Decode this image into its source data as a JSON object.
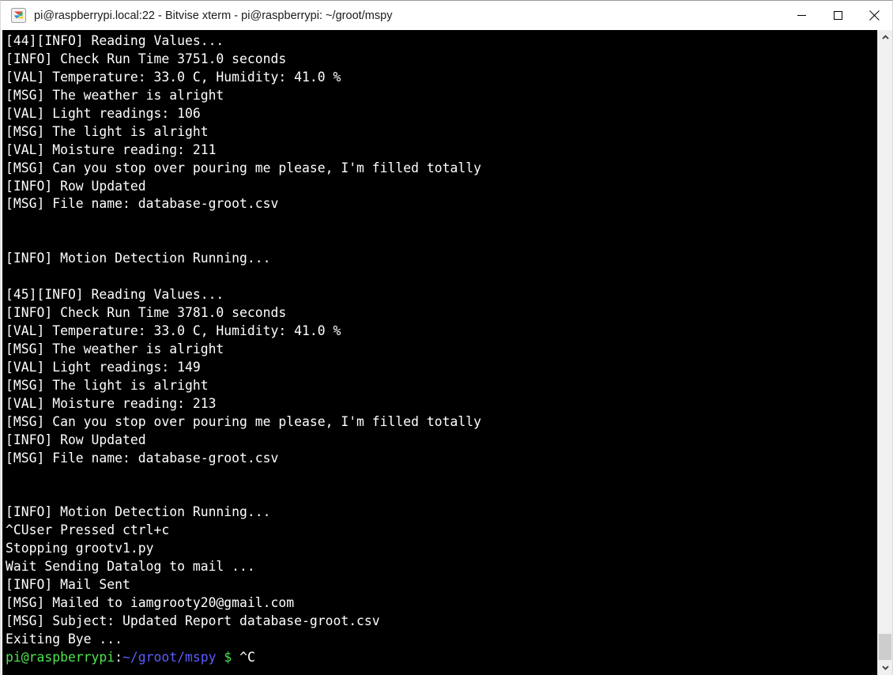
{
  "window": {
    "title": "pi@raspberrypi.local:22 - Bitvise xterm - pi@raspberrypi: ~/groot/mspy",
    "icon": "bitvise-logo-icon",
    "controls": {
      "minimize_label": "Minimize",
      "maximize_label": "Maximize",
      "close_label": "Close"
    }
  },
  "terminal": {
    "background_color": "#000000",
    "foreground_color": "#ffffff",
    "prompt_user_color": "#4ee44e",
    "prompt_path_color": "#5c5cff",
    "lines": [
      "[44][INFO] Reading Values...",
      "[INFO] Check Run Time 3751.0 seconds",
      "[VAL] Temperature: 33.0 C, Humidity: 41.0 %",
      "[MSG] The weather is alright",
      "[VAL] Light readings: 106",
      "[MSG] The light is alright",
      "[VAL] Moisture reading: 211",
      "[MSG] Can you stop over pouring me please, I'm filled totally",
      "[INFO] Row Updated",
      "[MSG] File name: database-groot.csv",
      "",
      "",
      "[INFO] Motion Detection Running...",
      "",
      "[45][INFO] Reading Values...",
      "[INFO] Check Run Time 3781.0 seconds",
      "[VAL] Temperature: 33.0 C, Humidity: 41.0 %",
      "[MSG] The weather is alright",
      "[VAL] Light readings: 149",
      "[MSG] The light is alright",
      "[VAL] Moisture reading: 213",
      "[MSG] Can you stop over pouring me please, I'm filled totally",
      "[INFO] Row Updated",
      "[MSG] File name: database-groot.csv",
      "",
      "",
      "[INFO] Motion Detection Running...",
      "^CUser Pressed ctrl+c",
      "Stopping grootv1.py",
      "Wait Sending Datalog to mail ...",
      "[INFO] Mail Sent",
      "[MSG] Mailed to iamgrooty20@gmail.com",
      "[MSG] Subject: Updated Report database-groot.csv",
      "Exiting Bye ..."
    ],
    "prompt": {
      "user_host": "pi@raspberrypi",
      "separator": ":",
      "path": "~/groot/mspy",
      "sigil": "$",
      "typed": " ^C"
    }
  },
  "scrollbar": {
    "up_arrow": "chevron-up-icon",
    "down_arrow": "chevron-down-icon",
    "thumb_position": "bottom"
  }
}
